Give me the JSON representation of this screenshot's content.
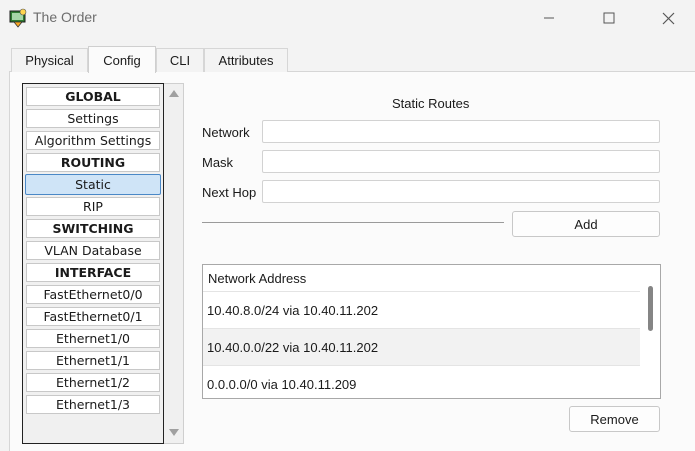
{
  "window": {
    "title": "The Order"
  },
  "tabs": [
    {
      "label": "Physical"
    },
    {
      "label": "Config"
    },
    {
      "label": "CLI"
    },
    {
      "label": "Attributes"
    }
  ],
  "sidebar": {
    "items": [
      {
        "label": "GLOBAL"
      },
      {
        "label": "Settings"
      },
      {
        "label": "Algorithm Settings"
      },
      {
        "label": "ROUTING"
      },
      {
        "label": "Static"
      },
      {
        "label": "RIP"
      },
      {
        "label": "SWITCHING"
      },
      {
        "label": "VLAN Database"
      },
      {
        "label": "INTERFACE"
      },
      {
        "label": "FastEthernet0/0"
      },
      {
        "label": "FastEthernet0/1"
      },
      {
        "label": "Ethernet1/0"
      },
      {
        "label": "Ethernet1/1"
      },
      {
        "label": "Ethernet1/2"
      },
      {
        "label": "Ethernet1/3"
      }
    ]
  },
  "static_routes": {
    "title": "Static Routes",
    "network_label": "Network",
    "network_value": "",
    "mask_label": "Mask",
    "mask_value": "",
    "next_hop_label": "Next Hop",
    "next_hop_value": "",
    "add_label": "Add",
    "list_header": "Network Address",
    "routes": [
      "10.40.8.0/24 via 10.40.11.202",
      "10.40.0.0/22 via 10.40.11.202",
      "0.0.0.0/0 via 10.40.11.209"
    ],
    "remove_label": "Remove"
  },
  "colors": {
    "selected_bg": "#cfe4f7",
    "selected_border": "#4a88c7"
  }
}
